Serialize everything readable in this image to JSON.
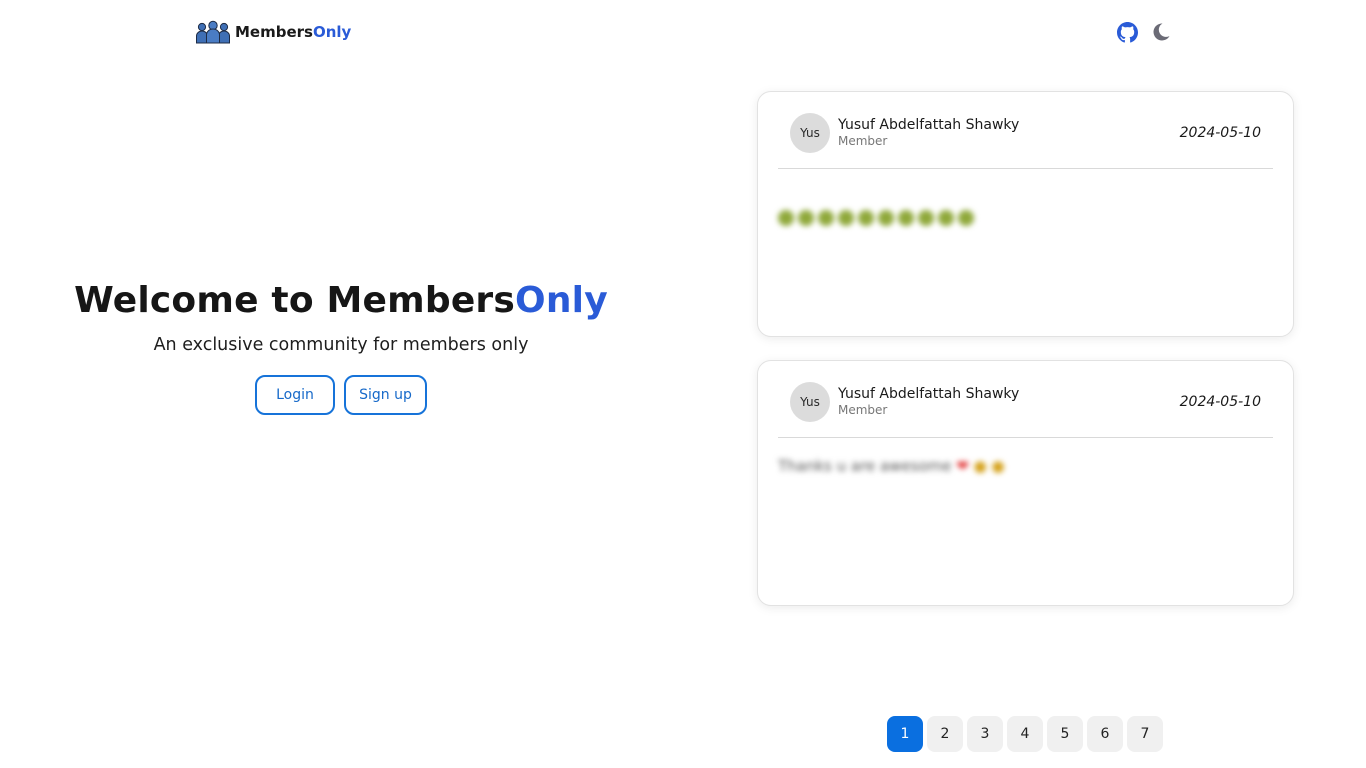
{
  "header": {
    "brand": {
      "name_main": "Members",
      "name_accent": "Only",
      "icon": "people-group-icon"
    },
    "actions": [
      {
        "icon": "github-icon",
        "color": "#2a5bd7"
      },
      {
        "icon": "moon-icon",
        "color": "#6b6b76"
      }
    ]
  },
  "hero": {
    "title_main": "Welcome to Members",
    "title_accent": "Only",
    "subtitle": "An exclusive community for members only",
    "login_label": "Login",
    "signup_label": "Sign up"
  },
  "messages": [
    {
      "avatar_text": "Yus",
      "author": "Yusuf Abdelfattah Shawky",
      "role": "Member",
      "date": "2024-05-10"
    },
    {
      "avatar_text": "Yus",
      "author": "Yusuf Abdelfattah Shawky",
      "role": "Member",
      "date": "2024-05-10",
      "body": "Thanks u are awesome"
    }
  ],
  "pagination": {
    "pages": [
      "1",
      "2",
      "3",
      "4",
      "5",
      "6",
      "7"
    ],
    "current": "1"
  },
  "colors": {
    "accent": "#2a5bd7",
    "button_border": "#1673d9",
    "active_page": "#0a6fe0"
  }
}
